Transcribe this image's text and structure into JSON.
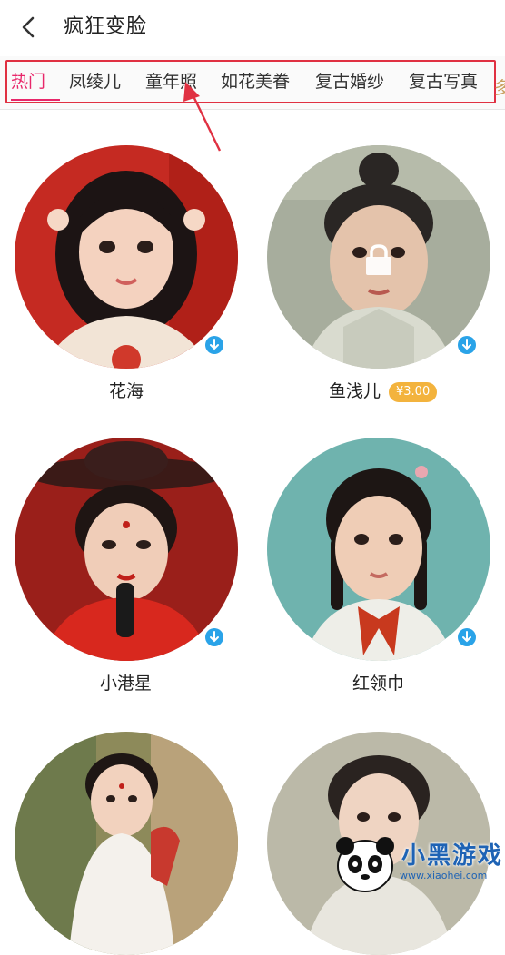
{
  "header": {
    "title": "疯狂变脸"
  },
  "tabs": [
    {
      "label": "热门",
      "active": true
    },
    {
      "label": "凤绫儿",
      "active": false
    },
    {
      "label": "童年照",
      "active": false
    },
    {
      "label": "如花美眷",
      "active": false
    },
    {
      "label": "复古婚纱",
      "active": false
    },
    {
      "label": "复古写真",
      "active": false
    }
  ],
  "cards": [
    {
      "name": "花海",
      "price": "",
      "locked": false,
      "downloadable": true
    },
    {
      "name": "鱼浅儿",
      "price": "¥3.00",
      "locked": true,
      "downloadable": true
    },
    {
      "name": "小港星",
      "price": "",
      "locked": false,
      "downloadable": true
    },
    {
      "name": "红领巾",
      "price": "",
      "locked": false,
      "downloadable": true
    }
  ],
  "watermark": {
    "brand": "小黑游戏",
    "url": "www.xiaohei.com"
  },
  "colors": {
    "accent": "#e8276a",
    "highlight_box": "#e03142",
    "download_badge": "#2aa3e8",
    "price_badge": "#f3b33d"
  },
  "icons": {
    "back": "chevron-left-icon",
    "download": "download-icon",
    "lock": "lock-icon"
  }
}
